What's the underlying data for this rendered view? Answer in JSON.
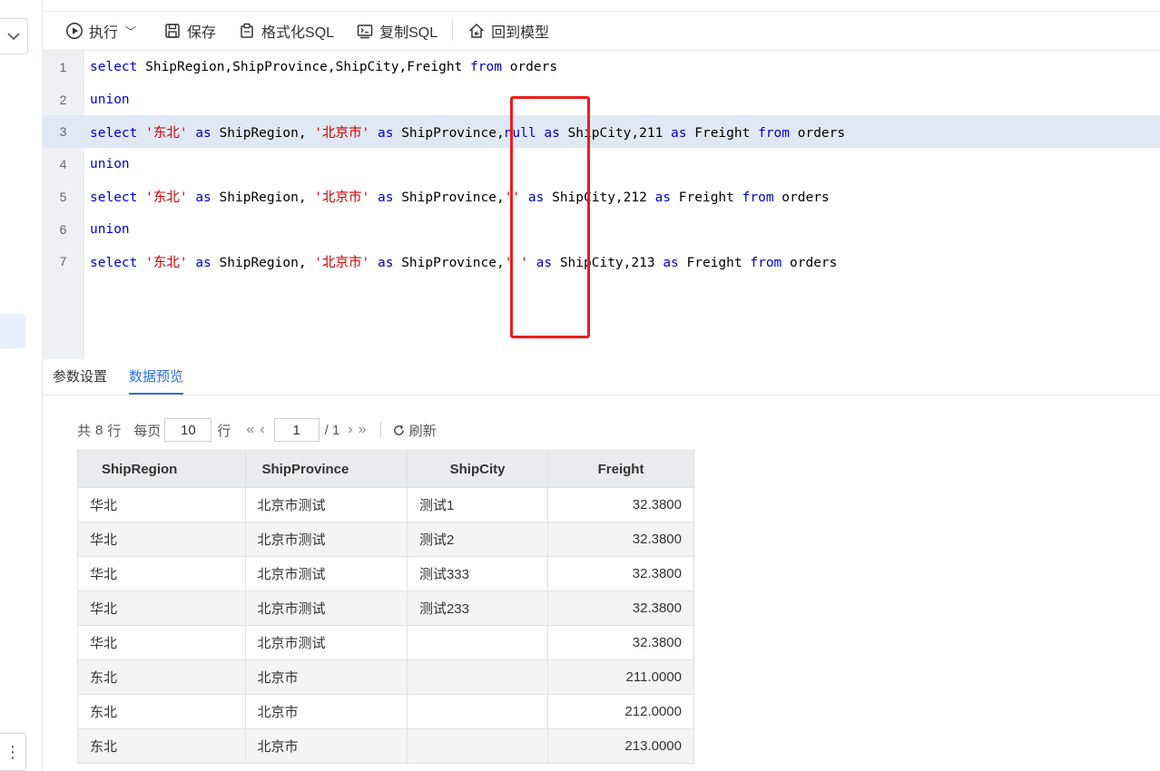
{
  "toolbar": {
    "run_label": "执行",
    "save_label": "保存",
    "format_label": "格式化SQL",
    "copy_label": "复制SQL",
    "back_label": "回到模型"
  },
  "editor": {
    "line_numbers": [
      "1",
      "2",
      "3",
      "4",
      "5",
      "6",
      "7"
    ],
    "lines": [
      [
        "select",
        " ShipRegion,ShipProvince,ShipCity,Freight ",
        "from",
        " orders"
      ],
      [
        "union"
      ],
      [
        "select",
        " ",
        "'东北'",
        " ",
        "as",
        " ShipRegion, ",
        "'北京市'",
        " ",
        "as",
        " ShipProvince,",
        "null",
        " ",
        "as",
        " ShipCity,211 ",
        "as",
        " Freight ",
        "from",
        " orders"
      ],
      [
        "union"
      ],
      [
        "select",
        " ",
        "'东北'",
        " ",
        "as",
        " ShipRegion, ",
        "'北京市'",
        " ",
        "as",
        " ShipProvince,",
        "''",
        " ",
        "as",
        " ShipCity,212 ",
        "as",
        " Freight ",
        "from",
        " orders"
      ],
      [
        "union"
      ],
      [
        "select",
        " ",
        "'东北'",
        " ",
        "as",
        " ShipRegion, ",
        "'北京市'",
        " ",
        "as",
        " ShipProvince,",
        "' '",
        " ",
        "as",
        " ShipCity,213 ",
        "as",
        " Freight ",
        "from",
        " orders"
      ]
    ]
  },
  "tabs": [
    "参数设置",
    "数据预览"
  ],
  "pager": {
    "total_prefix": "共",
    "total_count": "8",
    "total_suffix": "行",
    "per_page_label": "每页",
    "per_page_value": "10",
    "per_page_suffix": "行",
    "current_page": "1",
    "total_pages": "/ 1",
    "refresh_label": "刷新"
  },
  "table": {
    "headers": [
      "ShipRegion",
      "ShipProvince",
      "ShipCity",
      "Freight"
    ],
    "rows": [
      [
        "华北",
        "北京市测试",
        "测试1",
        "32.3800"
      ],
      [
        "华北",
        "北京市测试",
        "测试2",
        "32.3800"
      ],
      [
        "华北",
        "北京市测试",
        "测试333",
        "32.3800"
      ],
      [
        "华北",
        "北京市测试",
        "测试233",
        "32.3800"
      ],
      [
        "华北",
        "北京市测试",
        "",
        "32.3800"
      ],
      [
        "东北",
        "北京市",
        "",
        "211.0000"
      ],
      [
        "东北",
        "北京市",
        "",
        "212.0000"
      ],
      [
        "东北",
        "北京市",
        "",
        "213.0000"
      ]
    ]
  },
  "colors": {
    "accent": "#2f6fe0",
    "keyword": "#0000cc",
    "string": "#cc0000",
    "annotation": "#ee1c1c"
  }
}
